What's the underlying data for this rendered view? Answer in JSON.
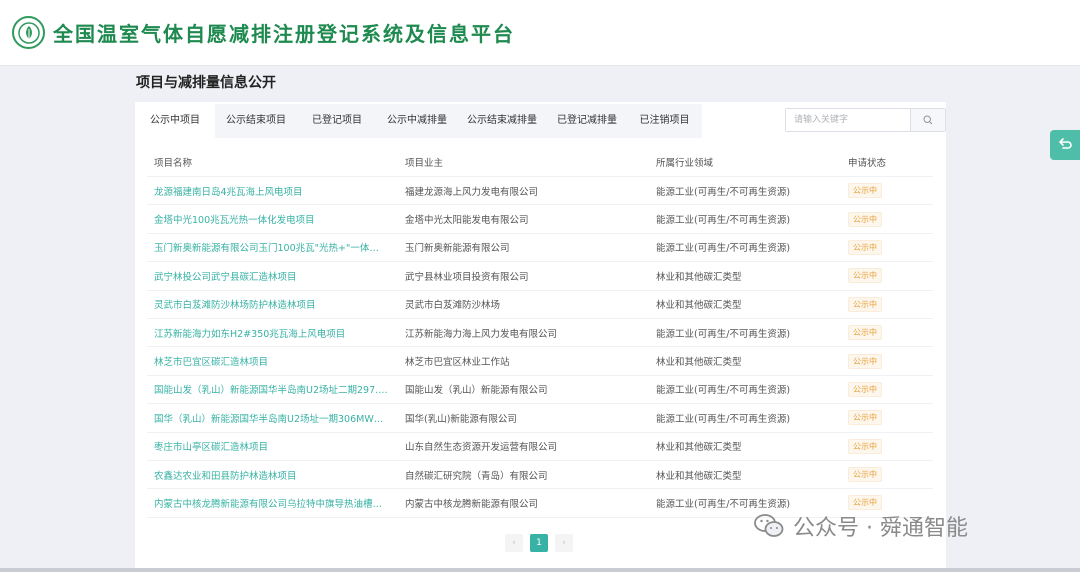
{
  "header": {
    "site_title": "全国温室气体自愿减排注册登记系统及信息平台"
  },
  "section": {
    "title": "项目与减排量信息公开"
  },
  "tabs": [
    {
      "label": "公示中项目",
      "active": true
    },
    {
      "label": "公示结束项目",
      "active": false
    },
    {
      "label": "已登记项目",
      "active": false
    },
    {
      "label": "公示中减排量",
      "active": false
    },
    {
      "label": "公示结束减排量",
      "active": false
    },
    {
      "label": "已登记减排量",
      "active": false
    },
    {
      "label": "已注销项目",
      "active": false
    }
  ],
  "search": {
    "placeholder": "请输入关键字",
    "value": ""
  },
  "table": {
    "headers": [
      "项目名称",
      "项目业主",
      "所属行业领域",
      "申请状态"
    ],
    "rows": [
      [
        "龙源福建南日岛4兆瓦海上风电项目",
        "福建龙源海上风力发电有限公司",
        "能源工业(可再生/不可再生资源)",
        "公示中"
      ],
      [
        "金塔中光100兆瓦光热一体化发电项目",
        "金塔中光太阳能发电有限公司",
        "能源工业(可再生/不可再生资源)",
        "公示中"
      ],
      [
        "玉门新奥新能源有限公司玉门100兆瓦\"光热+\"一体化发电...",
        "玉门新奥新能源有限公司",
        "能源工业(可再生/不可再生资源)",
        "公示中"
      ],
      [
        "武宁林投公司武宁县碳汇造林项目",
        "武宁县林业项目投资有限公司",
        "林业和其他碳汇类型",
        "公示中"
      ],
      [
        "灵武市白芨滩防沙林场防护林造林项目",
        "灵武市白芨滩防沙林场",
        "林业和其他碳汇类型",
        "公示中"
      ],
      [
        "江苏新能海力如东H2#350兆瓦海上风电项目",
        "江苏新能海力海上风力发电有限公司",
        "能源工业(可再生/不可再生资源)",
        "公示中"
      ],
      [
        "林芝市巴宜区碳汇造林项目",
        "林芝市巴宜区林业工作站",
        "林业和其他碳汇类型",
        "公示中"
      ],
      [
        "国能山发（乳山）新能源国华半岛南U2场址二期297.5M...",
        "国能山发（乳山）新能源有限公司",
        "能源工业(可再生/不可再生资源)",
        "公示中"
      ],
      [
        "国华（乳山）新能源国华半岛南U2场址一期306MW海上...",
        "国华(乳山)新能源有限公司",
        "能源工业(可再生/不可再生资源)",
        "公示中"
      ],
      [
        "枣庄市山亭区碳汇造林项目",
        "山东自然生态资源开发运营有限公司",
        "林业和其他碳汇类型",
        "公示中"
      ],
      [
        "农鑫达农业和田县防护林造林项目",
        "自然碳汇研究院（青岛）有限公司",
        "林业和其他碳汇类型",
        "公示中"
      ],
      [
        "内蒙古中核龙腾新能源有限公司乌拉特中旗导热油槽式10...",
        "内蒙古中核龙腾新能源有限公司",
        "能源工业(可再生/不可再生资源)",
        "公示中"
      ]
    ]
  },
  "pagination": {
    "prev": "‹",
    "current": "1",
    "next": "›"
  },
  "watermark": {
    "text": "公众号 · 舜通智能"
  },
  "colors": {
    "brand": "#1f8a4f",
    "accent": "#38b2a5",
    "status": "#e6a23c"
  }
}
